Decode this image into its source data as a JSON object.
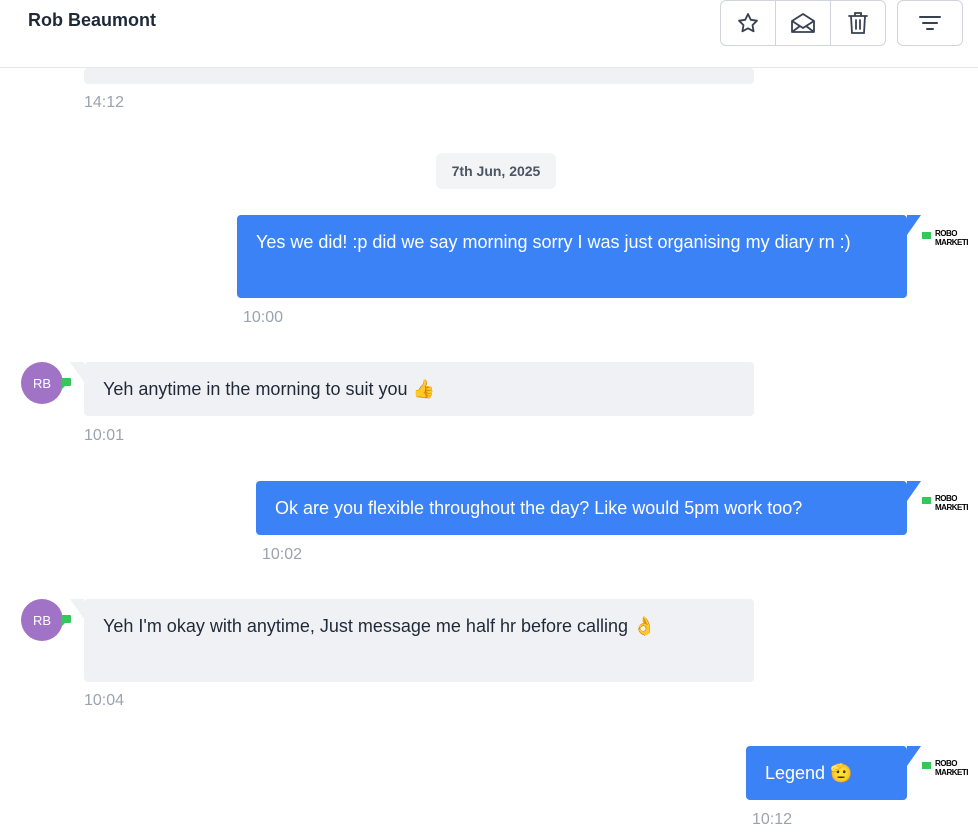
{
  "header": {
    "contact_name": "Rob Beaumont",
    "actions": [
      {
        "name": "star-icon"
      },
      {
        "name": "envelope-open-icon"
      },
      {
        "name": "trash-icon"
      }
    ],
    "filter": {
      "name": "filter-icon"
    }
  },
  "thread": {
    "prev_time": "14:12",
    "date_separator": "7th Jun, 2025",
    "messages": [
      {
        "direction": "outgoing",
        "text": "Yes we did! :p did we say morning sorry I was just organising my diary rn :)",
        "time": "10:00"
      },
      {
        "direction": "incoming",
        "initials": "RB",
        "text": "Yeh anytime in the morning to suit you 👍",
        "time": "10:01"
      },
      {
        "direction": "outgoing",
        "text": "Ok are you flexible throughout the day? Like would 5pm work too?",
        "time": "10:02"
      },
      {
        "direction": "incoming",
        "initials": "RB",
        "text": "Yeh I'm okay with anytime, Just message me half hr before calling 👌",
        "time": "10:04"
      },
      {
        "direction": "outgoing",
        "text": "Legend 🫡",
        "time": "10:12"
      }
    ],
    "sender_logo": {
      "line1": "ROBO",
      "line2": "MARKETI"
    }
  },
  "colors": {
    "outgoing_bubble": "#3b82f6",
    "incoming_bubble": "#f0f1f5",
    "avatar": "#a173c6",
    "sms_badge": "#34c759"
  }
}
